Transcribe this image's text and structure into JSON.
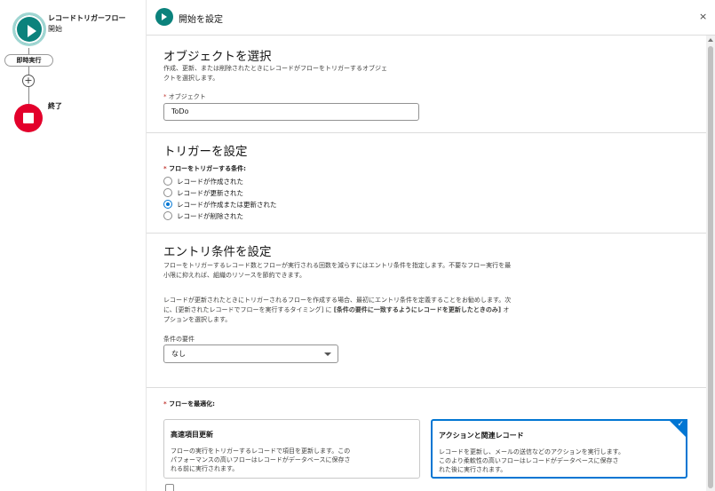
{
  "canvas": {
    "start_title": "レコードトリガーフロー",
    "start_sub": "開始",
    "pill_label": "即時実行",
    "add_label": "+",
    "end_label": "終了"
  },
  "panel": {
    "title": "開始を設定",
    "close": "×"
  },
  "object_section": {
    "title": "オブジェクトを選択",
    "desc_line1": "作成、更新、または削除されたときにレコードがフローをトリガーするオブジェ",
    "desc_line2": "クトを選択します。",
    "field_label": "オブジェクト",
    "field_value": "ToDo"
  },
  "trigger_section": {
    "title": "トリガーを設定",
    "field_label": "フローをトリガーする条件:",
    "options": [
      {
        "label": "レコードが作成された",
        "selected": false
      },
      {
        "label": "レコードが更新された",
        "selected": false
      },
      {
        "label": "レコードが作成または更新された",
        "selected": true
      },
      {
        "label": "レコードが削除された",
        "selected": false
      }
    ]
  },
  "entry_section": {
    "title": "エントリ条件を設定",
    "desc1_line1": "フローをトリガーするレコード数とフローが実行される回数を減らすにはエントリ条件を指定します。不要なフロー実行を最",
    "desc1_line2": "小限に抑えれば、組織のリソースを節約できます。",
    "desc2_line1": "レコードが更新されたときにトリガーされるフローを作成する場合、最初にエントリ条件を定義することをお勧めします。次",
    "desc2_line2_a": "に、[更新されたレコードでフローを実行するタイミング] に ",
    "desc2_line2_b": "[条件の要件に一致するようにレコードを更新したときのみ]",
    "desc2_line2_c": " オ",
    "desc2_line3": "プションを選択します。",
    "cond_label": "条件の要件",
    "cond_value": "なし"
  },
  "optimize_section": {
    "field_label": "フローを最適化:",
    "cards": [
      {
        "title": "高速項目更新",
        "desc_line1": "フローの実行をトリガーするレコードで項目を更新します。この",
        "desc_line2": "パフォーマンスの高いフローはレコードがデータベースに保存さ",
        "desc_line3": "れる前に実行されます。",
        "selected": false
      },
      {
        "title": "アクションと関連レコード",
        "desc_line1": "レコードを更新し、メールの送信などのアクションを実行します。",
        "desc_line2": "このより柔軟性の高いフローはレコードがデータベースに保存さ",
        "desc_line3": "れた後に実行されます。",
        "selected": true
      }
    ]
  },
  "colors": {
    "start": "#0b827c",
    "end": "#e3002b",
    "accent": "#0176d3"
  }
}
